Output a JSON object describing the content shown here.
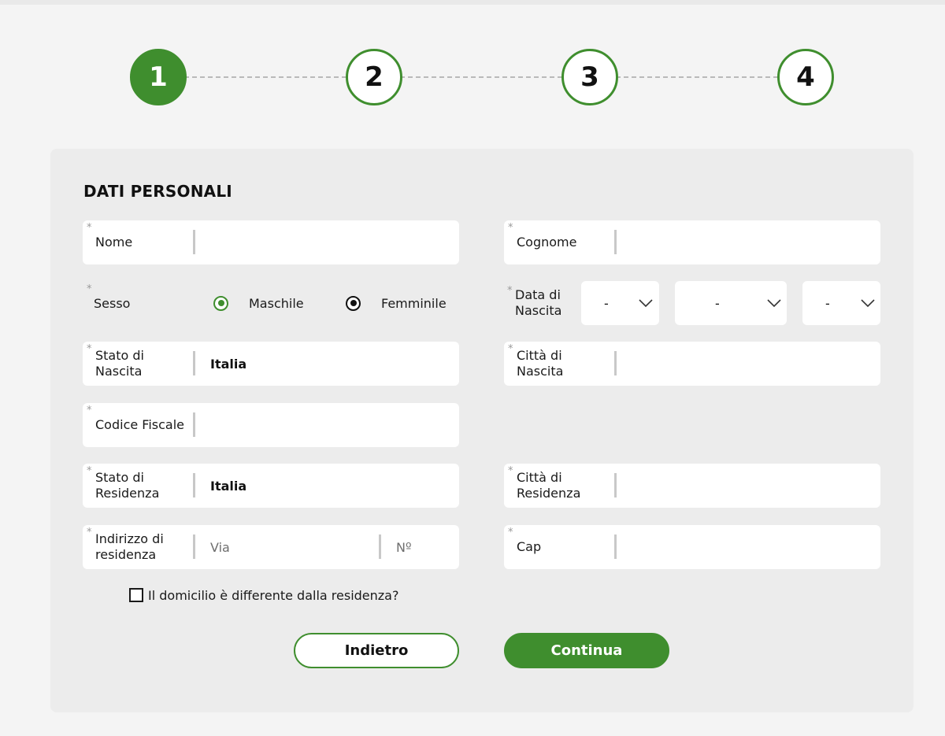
{
  "stepper": {
    "steps": [
      "1",
      "2",
      "3",
      "4"
    ],
    "active_step": 1
  },
  "form": {
    "title": "DATI PERSONALI",
    "required_marker": "*",
    "nome": {
      "label": "Nome",
      "value": ""
    },
    "cognome": {
      "label": "Cognome",
      "value": ""
    },
    "sesso": {
      "label": "Sesso",
      "options": [
        "Maschile",
        "Femminile"
      ],
      "selected": "Maschile"
    },
    "data_nascita": {
      "label": "Data di Nascita",
      "day": "-",
      "month": "-",
      "year": "-"
    },
    "stato_nascita": {
      "label": "Stato di Nascita",
      "value": "Italia"
    },
    "citta_nascita": {
      "label": "Città di Nascita",
      "value": ""
    },
    "codice_fiscale": {
      "label": "Codice Fiscale",
      "value": ""
    },
    "stato_residenza": {
      "label": "Stato di Residenza",
      "value": "Italia"
    },
    "citta_residenza": {
      "label": "Città di Residenza",
      "value": ""
    },
    "indirizzo": {
      "label": "Indirizzo di residenza",
      "via_placeholder": "Via",
      "numero_placeholder": "Nº"
    },
    "cap": {
      "label": "Cap",
      "value": ""
    },
    "domicilio_checkbox": {
      "label": "Il domicilio è differente dalla residenza?",
      "checked": false
    }
  },
  "buttons": {
    "back": "Indietro",
    "next": "Continua"
  },
  "colors": {
    "accent": "#3f8e2e",
    "page_bg": "#f4f4f4",
    "card_bg": "#ececec"
  },
  "icons": {
    "select_arrow": "chevron-down-icon",
    "radio": "radio-icon",
    "checkbox": "checkbox-icon"
  }
}
